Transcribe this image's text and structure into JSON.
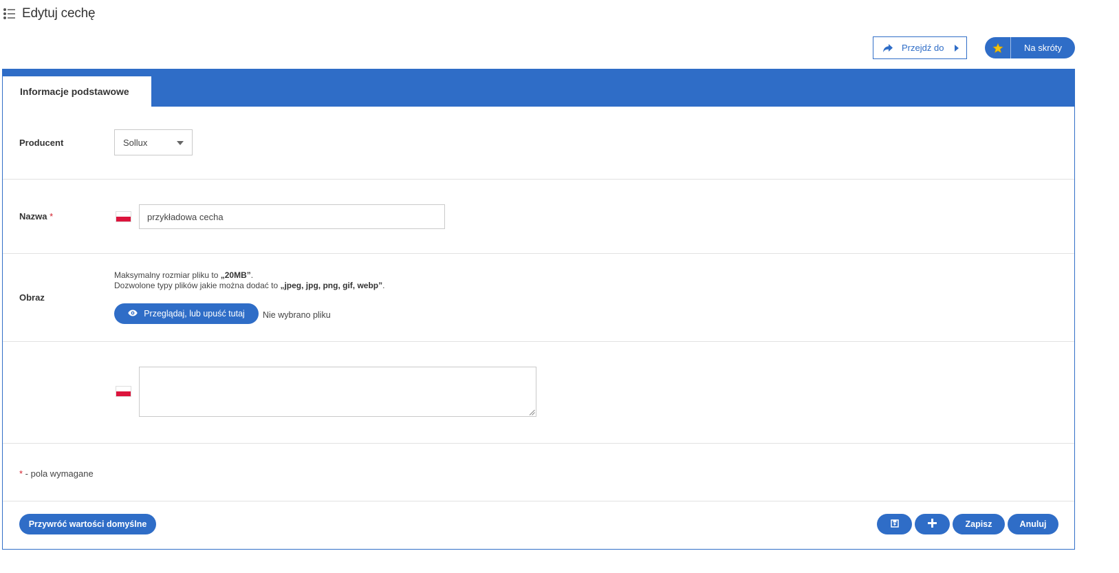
{
  "header": {
    "title": "Edytuj cechę",
    "goto_label": "Przejdź do",
    "shortcuts_label": "Na skróty"
  },
  "tabs": [
    {
      "label": "Informacje podstawowe",
      "active": true
    }
  ],
  "form": {
    "producer": {
      "label": "Producent",
      "value": "Sollux"
    },
    "name": {
      "label": "Nazwa",
      "required_mark": "*",
      "value": "przykładowa cecha",
      "language_flag": "pl-flag-icon"
    },
    "image": {
      "label": "Obraz",
      "hint_line1_prefix": "Maksymalny rozmiar pliku to ",
      "hint_line1_value": "„20MB”",
      "hint_line1_suffix": ".",
      "hint_line2_prefix": "Dozwolone typy plików jakie można dodać to ",
      "hint_line2_value": "„jpeg, jpg, png, gif, webp”",
      "hint_line2_suffix": ".",
      "browse_label": "Przeglądaj, lub upuść tutaj",
      "file_status": "Nie wybrano pliku"
    },
    "description": {
      "label": "",
      "value": "",
      "language_flag": "pl-flag-icon"
    },
    "required_note_star": "*",
    "required_note_text": " - pola wymagane"
  },
  "footer": {
    "reset_label": "Przywróć wartości domyślne",
    "save_label": "Zapisz",
    "cancel_label": "Anuluj",
    "save_return_icon": "save-return-icon",
    "add_icon": "plus-icon"
  },
  "colors": {
    "accent": "#2f6dc7",
    "required": "#d21f2b"
  }
}
